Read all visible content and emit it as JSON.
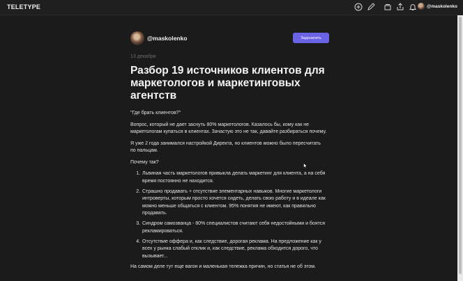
{
  "header": {
    "logo": "TELETYPE",
    "username": "@maskolenko",
    "icons": [
      "plus-circle-icon",
      "pencil-icon",
      "layers-icon",
      "share-icon",
      "bell-icon"
    ]
  },
  "author": {
    "name": "@maskolenko",
    "subscribe_label": "Задонатить"
  },
  "article": {
    "date": "13 декабря",
    "title": "Разбор 19 источников клиентов для маркетологов и маркетинговых агентств",
    "paragraphs": [
      "\"Где брать клиентов?\"",
      "Вопрос, который не дает заснуть 80% маркетологов. Казалось бы, кому как не маркетологам купаться в клиентах. Зачастую это не так, давайте разбираться почему.",
      "Я уже 2 года занимался настройкой Директа, но клиентов можно было пересчитать по пальцам.",
      "Почему так?"
    ],
    "list": [
      "Львиная часть маркетологов привыкла делать маркетинг для клиента, а на себя время постоянно не находится.",
      "Страшно продавать + отсутствие элементарных навыков. Многие маркетологи интроверты, которым просто хочется сидеть, делать свою работу и в идеале как можно меньше общаться с клиентом. 95% понятия не имеют, как правильно продавать.",
      "Синдром самозванца - 80% специалистов считают себя недостойными и боятся рекламироваться.",
      "Отсутствие оффера и, как следствие, дорогая реклама. На предложение как у всех у рынка слабый отклик и, как следствие, реклама обходится дорого, что вызывает..."
    ],
    "closing": "На самом деле тут еще вагон и маленькая тележка причин, но статья не об этом."
  }
}
